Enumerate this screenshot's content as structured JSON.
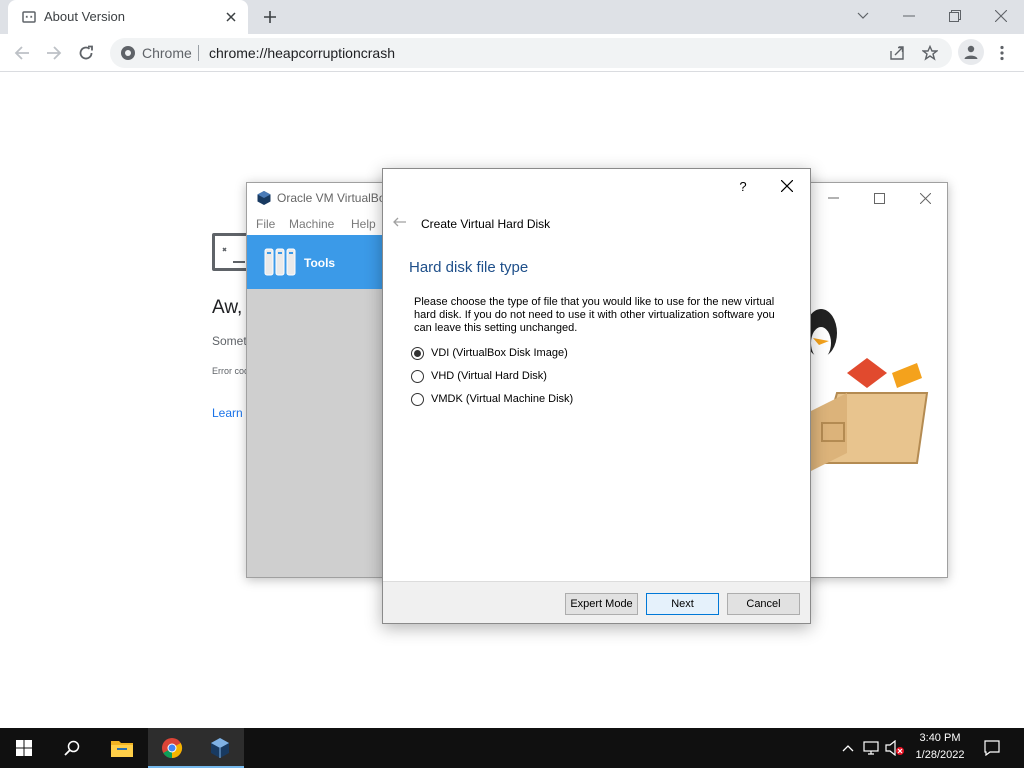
{
  "browser": {
    "tab_title": "About Version",
    "omnibox_label": "Chrome",
    "url": "chrome://heapcorruptioncrash"
  },
  "crash_page": {
    "heading": "Aw,",
    "body": "Somet",
    "error_code": "Error cod",
    "learn_more": "Learn"
  },
  "virtualbox": {
    "title": "Oracle VM VirtualBox",
    "menus": [
      "File",
      "Machine",
      "Help"
    ],
    "tools_label": "Tools"
  },
  "dialog": {
    "help_symbol": "?",
    "wizard_title": "Create Virtual Hard Disk",
    "heading": "Hard disk file type",
    "description": "Please choose the type of file that you would like to use for the new virtual hard disk. If you do not need to use it with other virtualization software you can leave this setting unchanged.",
    "options": [
      {
        "label": "VDI (VirtualBox Disk Image)",
        "selected": true
      },
      {
        "label": "VHD (Virtual Hard Disk)",
        "selected": false
      },
      {
        "label": "VMDK (Virtual Machine Disk)",
        "selected": false
      }
    ],
    "buttons": {
      "expert": "Expert Mode",
      "next": "Next",
      "cancel": "Cancel"
    }
  },
  "taskbar": {
    "time": "3:40 PM",
    "date": "1/28/2022"
  },
  "colors": {
    "accent_blue": "#3b9ae8",
    "heading_blue": "#1e4f8a",
    "taskbar": "#101010"
  }
}
